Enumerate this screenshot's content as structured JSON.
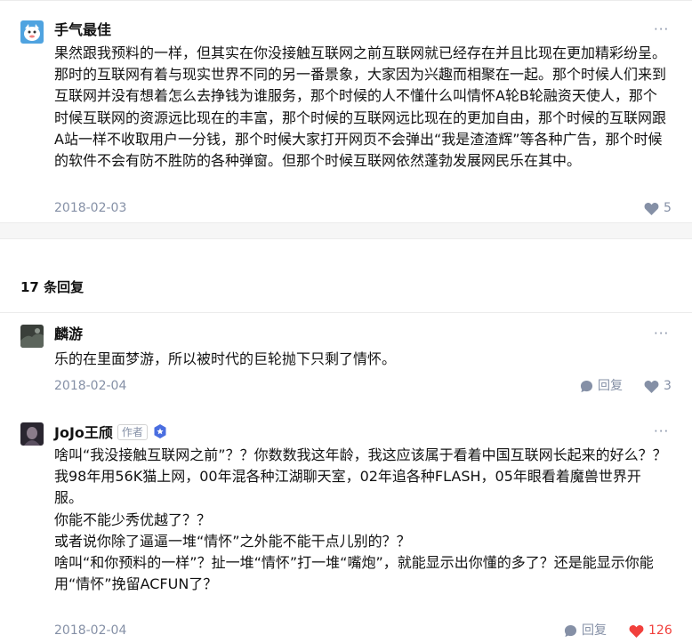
{
  "main_comment": {
    "author": "手气最佳",
    "content": "果然跟我预料的一样，但其实在你没接触互联网之前互联网就已经存在并且比现在更加精彩纷呈。那时的互联网有着与现实世界不同的另一番景象，大家因为兴趣而相聚在一起。那个时候人们来到互联网并没有想着怎么去挣钱为谁服务，那个时候的人不懂什么叫情怀A轮B轮融资天使人，那个时候互联网的资源远比现在的丰富，那个时候的互联网远比现在的更加自由，那个时候的互联网跟A站一样不收取用户一分钱，那个时候大家打开网页不会弹出“我是渣渣辉”等各种广告，那个时候的软件不会有防不胜防的各种弹窗。但那个时候互联网依然蓬勃发展网民乐在其中。",
    "date": "2018-02-03",
    "likes": "5"
  },
  "replies_header": "17 条回复",
  "replies": [
    {
      "author": "麟游",
      "content": "乐的在里面梦游，所以被时代的巨轮抛下只剩了情怀。",
      "date": "2018-02-04",
      "reply_label": "回复",
      "likes": "3"
    },
    {
      "author": "JoJo王颀",
      "author_tag": "作者",
      "content": "啥叫“我没接触互联网之前”？？你数数我这年龄，我这应该属于看着中国互联网长起来的好么？？\n我98年用56K猫上网，00年混各种江湖聊天室，02年追各种FLASH，05年眼看着魔兽世界开服。\n你能不能少秀优越了？？\n或者说你除了逼逼一堆“情怀”之外能不能干点儿别的？？\n啥叫“和你预料的一样”？扯一堆“情怀”打一堆“嘴炮”，就能显示出你懂的多了？还是能显示你能用“情怀”挽留ACFUN了？",
      "date": "2018-02-04",
      "reply_label": "回复",
      "likes": "126",
      "liked": true
    }
  ],
  "icons": {
    "more": "more-dots-icon",
    "like": "heart-icon",
    "reply": "reply-bubble-icon",
    "verified": "verified-badge-icon"
  },
  "colors": {
    "meta": "#8590a6",
    "liked": "#f1403c",
    "badge": "#4a6ee0"
  }
}
